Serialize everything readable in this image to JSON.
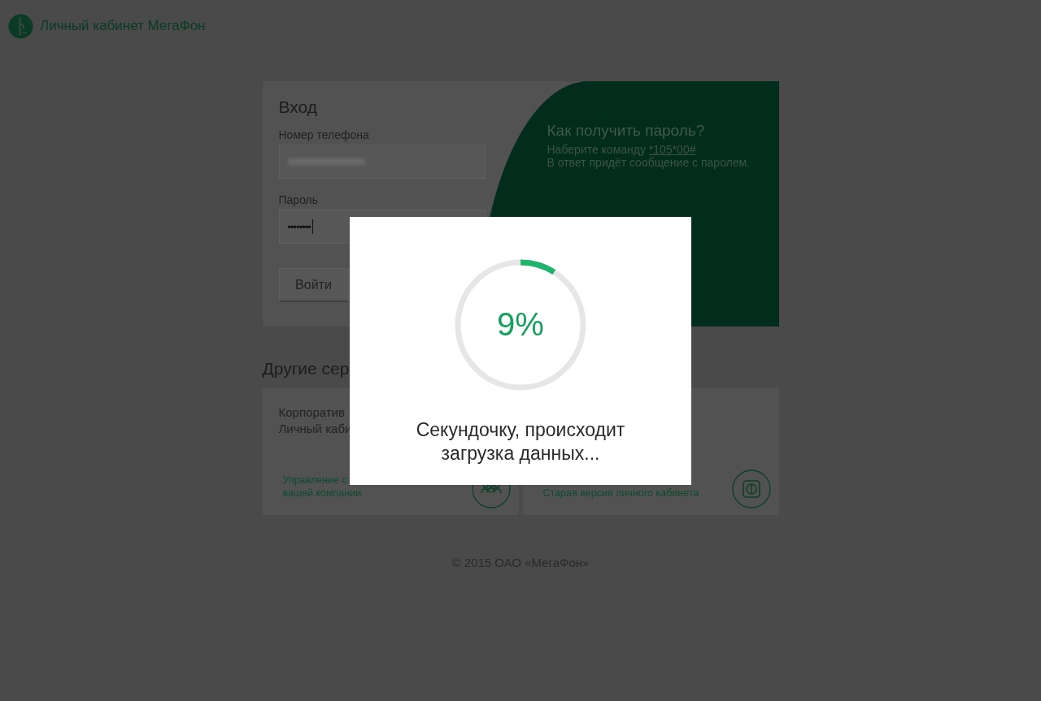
{
  "header": {
    "title": "Личный кабинет МегаФон"
  },
  "login": {
    "title": "Вход",
    "phone_label": "Номер телефона",
    "password_label": "Пароль",
    "password_value": "••••••••",
    "submit": "Войти"
  },
  "help": {
    "title": "Как получить пароль?",
    "line_prefix": "Наберите команду ",
    "command": "*105*00#",
    "line_2": "В ответ придёт сообщение с паролем."
  },
  "services": {
    "title": "Другие сер",
    "cards": [
      {
        "kind": "corporate",
        "title_lines": [
          "Корпоратив",
          "Личный каби"
        ],
        "link_lines": [
          "Управление с",
          "вашей компании"
        ]
      },
      {
        "kind": "legacy",
        "link_lines": [
          "Старая версия личного кабинета"
        ]
      }
    ]
  },
  "footer": "© 2015 ОАО «МегаФон»",
  "loading": {
    "percent": "9%",
    "level": 0.09,
    "message": "Секундочку, происходит загрузка данных..."
  }
}
